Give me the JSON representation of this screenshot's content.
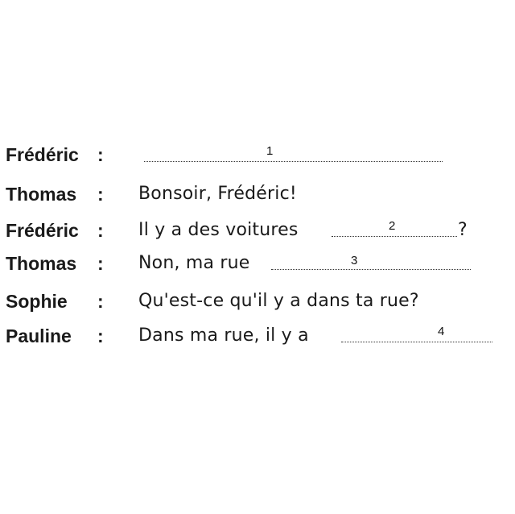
{
  "dialogue": [
    {
      "speaker": "Frédéric",
      "colon": ":",
      "text": "",
      "blank_number": "1",
      "after": ""
    },
    {
      "speaker": "Thomas",
      "colon": ":",
      "text": "Bonsoir, Frédéric!",
      "blank_number": "",
      "after": ""
    },
    {
      "speaker": "Frédéric",
      "colon": ":",
      "text": "Il  y a des voitures",
      "blank_number": "2",
      "after": "?"
    },
    {
      "speaker": "Thomas",
      "colon": ":",
      "text": "Non, ma rue",
      "blank_number": "3",
      "after": ""
    },
    {
      "speaker": "Sophie",
      "colon": ":",
      "text": "Qu'est-ce qu'il y a dans ta rue?",
      "blank_number": "",
      "after": ""
    },
    {
      "speaker": "Pauline",
      "colon": ":",
      "text": "Dans ma rue, il y a",
      "blank_number": "4",
      "after": ""
    }
  ]
}
